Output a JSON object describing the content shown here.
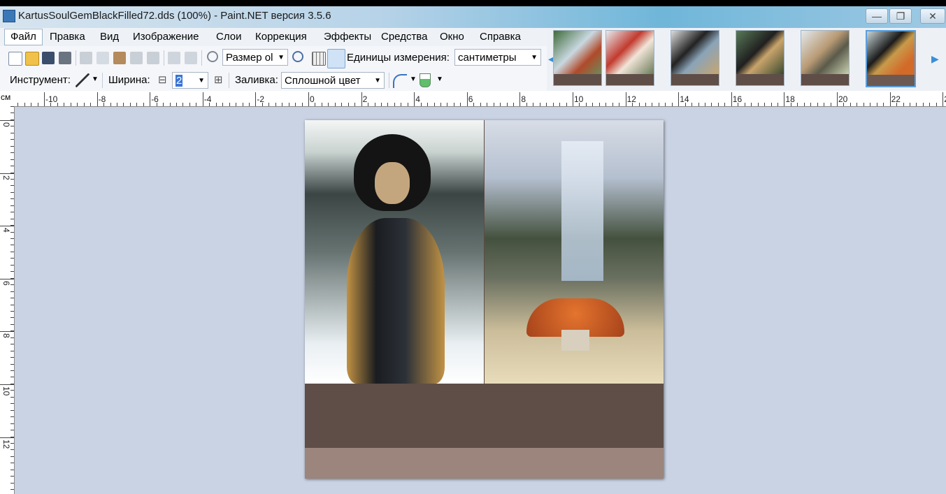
{
  "window": {
    "title": "KartusSoulGemBlackFilled72.dds (100%) - Paint.NET версия 3.5.6",
    "minimize": "—",
    "maximize": "❐",
    "close": "✕"
  },
  "menu": [
    "Файл",
    "Правка",
    "Вид",
    "Изображение",
    "Слои",
    "Коррекция",
    "Эффекты",
    "Средства",
    "Окно",
    "Справка"
  ],
  "toolbar": {
    "zoom_value": "Размер ol",
    "units_label": "Единицы измерения:",
    "units_value": "сантиметры"
  },
  "toolbar2": {
    "tool_label": "Инструмент:",
    "width_label": "Ширина:",
    "width_value": "2",
    "fill_label": "Заливка:",
    "fill_value": "Сплошной цвет"
  },
  "ruler": {
    "unit": "см",
    "h_labels": [
      "-10",
      "-8",
      "-6",
      "-4",
      "-2",
      "0",
      "2",
      "4",
      "6",
      "8",
      "10",
      "12",
      "14",
      "16",
      "18",
      "20",
      "22",
      "2"
    ],
    "v_labels": [
      "0",
      "2",
      "4",
      "6",
      "8",
      "10",
      "12"
    ]
  },
  "thumbnails": [
    "thumb-1",
    "thumb-2",
    "thumb-3",
    "thumb-4",
    "thumb-5",
    "thumb-6-selected"
  ]
}
